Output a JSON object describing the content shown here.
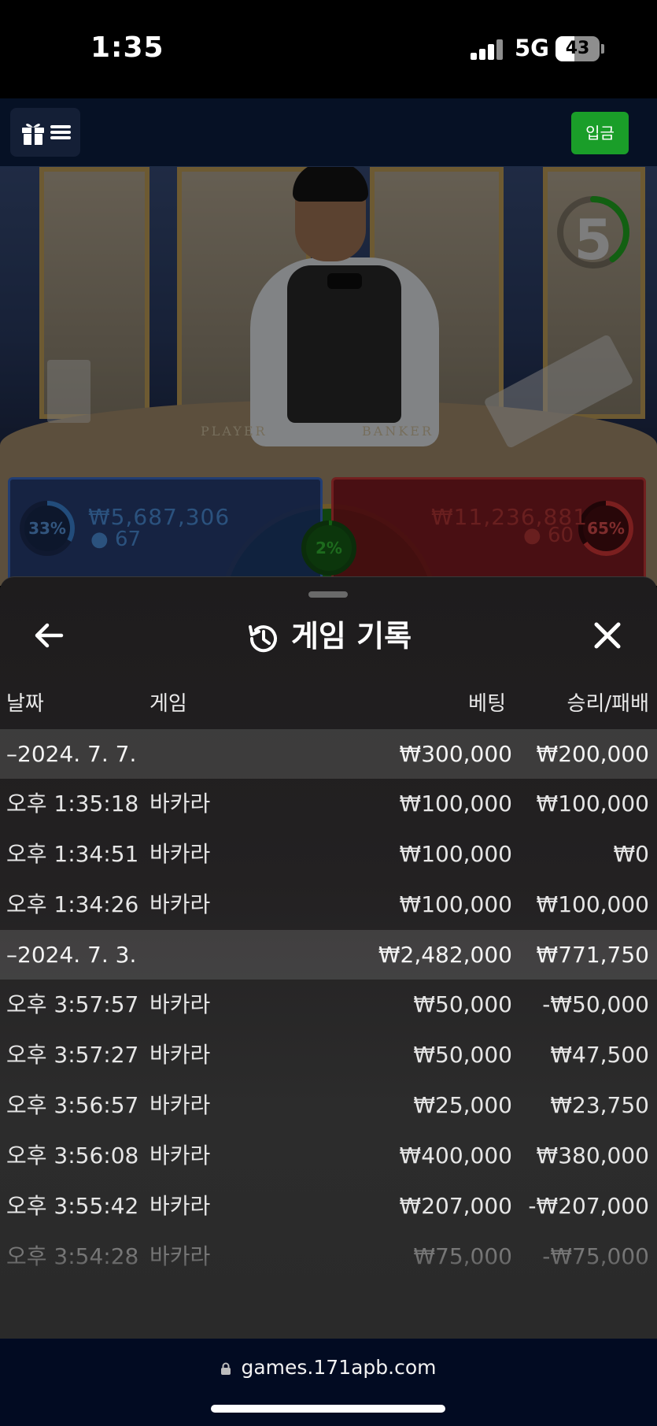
{
  "status_bar": {
    "time": "1:35",
    "network": "5G",
    "battery": "43"
  },
  "header": {
    "menu_icons": [
      "gift-icon",
      "hamburger-icon"
    ],
    "deposit_label": "입금"
  },
  "game": {
    "countdown": "5",
    "countdown_fraction": 0.4,
    "table_labels": {
      "player": "PLAYER",
      "banker": "BANKER"
    },
    "player": {
      "percent": "33%",
      "percent_value": 0.33,
      "amount": "₩5,687,306",
      "count": "67"
    },
    "banker": {
      "percent": "65%",
      "percent_value": 0.65,
      "amount": "₩11,236,881",
      "count": "60"
    },
    "tie": {
      "percent": "2%",
      "percent_value": 0.02
    },
    "colors": {
      "player": "#3e6fd0",
      "banker": "#d03a3a",
      "tie": "#22b022",
      "timer": "#22b022"
    }
  },
  "history": {
    "title": "게임 기록",
    "columns": {
      "date": "날짜",
      "game": "게임",
      "bet": "베팅",
      "result": "승리/패배"
    },
    "groups": [
      {
        "date": "–2024. 7. 7.",
        "bet": "₩300,000",
        "result": "₩200,000",
        "rows": [
          {
            "time": "오후 1:35:18",
            "game": "바카라",
            "bet": "₩100,000",
            "result": "₩100,000"
          },
          {
            "time": "오후 1:34:51",
            "game": "바카라",
            "bet": "₩100,000",
            "result": "₩0"
          },
          {
            "time": "오후 1:34:26",
            "game": "바카라",
            "bet": "₩100,000",
            "result": "₩100,000"
          }
        ]
      },
      {
        "date": "–2024. 7. 3.",
        "bet": "₩2,482,000",
        "result": "₩771,750",
        "rows": [
          {
            "time": "오후 3:57:57",
            "game": "바카라",
            "bet": "₩50,000",
            "result": "-₩50,000"
          },
          {
            "time": "오후 3:57:27",
            "game": "바카라",
            "bet": "₩50,000",
            "result": "₩47,500"
          },
          {
            "time": "오후 3:56:57",
            "game": "바카라",
            "bet": "₩25,000",
            "result": "₩23,750"
          },
          {
            "time": "오후 3:56:08",
            "game": "바카라",
            "bet": "₩400,000",
            "result": "₩380,000"
          },
          {
            "time": "오후 3:55:42",
            "game": "바카라",
            "bet": "₩207,000",
            "result": "-₩207,000"
          },
          {
            "time": "오후 3:54:28",
            "game": "바카라",
            "bet": "₩75,000",
            "result": "-₩75,000"
          }
        ]
      }
    ]
  },
  "browser": {
    "url": "games.171apb.com"
  }
}
